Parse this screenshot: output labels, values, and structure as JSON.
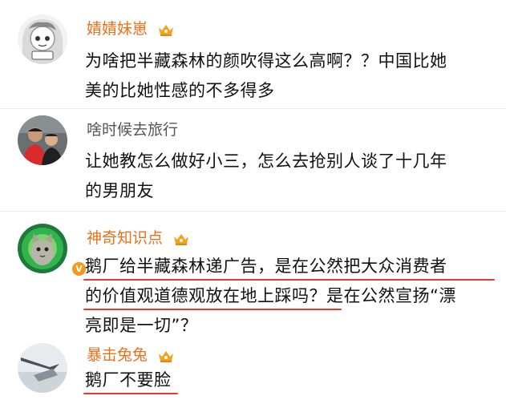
{
  "comments": [
    {
      "username": "婧婧妹崽",
      "name_color": "#e8711a",
      "has_vip_crown": true,
      "lines": [
        "为啥把半藏森林的颜吹得这么高啊？？中国比她",
        "美的比她性感的不多得多"
      ]
    },
    {
      "username": "啥时候去旅行",
      "name_color": "#555555",
      "has_vip_crown": false,
      "lines": [
        "让她教怎么做好小三，怎么去抢别人谈了十几年",
        "的男朋友"
      ]
    },
    {
      "username": "神奇知识点",
      "name_color": "#e8711a",
      "has_vip_crown": true,
      "verified": true,
      "lines": [
        "鹅厂给半藏森林递广告，是在公然把大众消费者",
        "的价值观道德观放在地上踩吗？是在公然宣扬“漂",
        "亮即是一切”？"
      ]
    },
    {
      "username": "暴击兔兔",
      "name_color": "#e8711a",
      "has_vip_crown": true,
      "lines": [
        "鹅厂不要脸"
      ]
    }
  ],
  "colors": {
    "underline": "#e23a2e",
    "vip_crown": "#f3a21b",
    "text": "#111111"
  }
}
